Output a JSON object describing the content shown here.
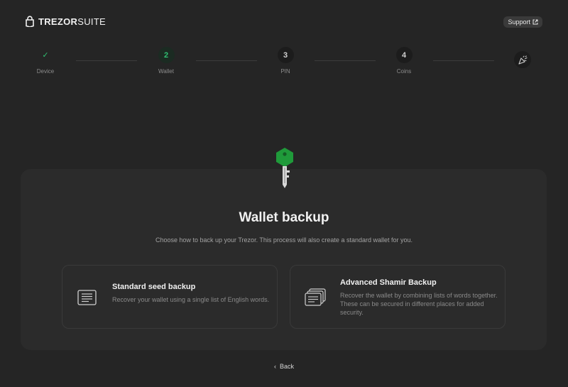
{
  "header": {
    "brand_bold": "TREZOR",
    "brand_light": "SUITE",
    "support_label": "Support"
  },
  "stepper": {
    "steps": [
      {
        "number": "✓",
        "label": "Device",
        "state": "done"
      },
      {
        "number": "2",
        "label": "Wallet",
        "state": "active"
      },
      {
        "number": "3",
        "label": "PIN",
        "state": "pending"
      },
      {
        "number": "4",
        "label": "Coins",
        "state": "pending"
      }
    ],
    "final_icon": "party-popper-icon"
  },
  "main": {
    "title": "Wallet backup",
    "subtitle": "Choose how to back up your Trezor. This process will also create a standard wallet for you.",
    "options": [
      {
        "title": "Standard seed backup",
        "description": "Recover your wallet using a single list of English words.",
        "icon": "single-list-icon"
      },
      {
        "title": "Advanced Shamir Backup",
        "description": "Recover the wallet by combining lists of words together. These can be secured in different places for added security.",
        "icon": "stacked-lists-icon"
      }
    ]
  },
  "footer": {
    "back_label": "Back"
  },
  "colors": {
    "background": "#252525",
    "card": "#2b2b2b",
    "accent_green": "#2fbf71",
    "key_green": "#1f9a3a"
  }
}
